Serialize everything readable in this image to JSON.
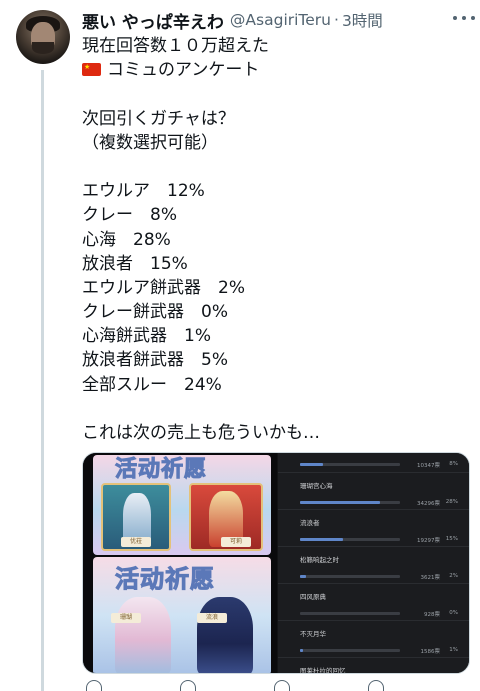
{
  "tweet": {
    "author_name": "悪い やっぱ辛えわ",
    "author_handle": "@AsagiriTeru",
    "separator": "·",
    "time": "3時間",
    "lines": [
      "現在回答数１０万超えた",
      "コミュのアンケート",
      "",
      "次回引くガチャは？",
      "（複数選択可能）",
      "",
      "エウルア　12%",
      "クレー　8%",
      "心海　28%",
      "放浪者　15%",
      "エウルア餅武器　2%",
      "クレー餅武器　0%",
      "心海餅武器　1%",
      "放浪者餅武器　5%",
      "全部スルー　24%",
      "",
      "これは次の売上も危ういかも…"
    ]
  },
  "media": {
    "left": {
      "banner_title_top": "活动祈愿",
      "banner_title_bottom": "活动祈愿",
      "card1_name_left": "优菈",
      "card1_name_right": "可莉",
      "card2_name_left": "珊瑚",
      "card2_name_right": "流浪"
    },
    "poll": [
      {
        "label": "",
        "count": "10347票",
        "pct": "8%",
        "fill": 0.08
      },
      {
        "label": "珊瑚宫心海",
        "count": "34296票",
        "pct": "28%",
        "fill": 0.28
      },
      {
        "label": "流浪者",
        "count": "19297票",
        "pct": "15%",
        "fill": 0.15
      },
      {
        "label": "松籁响起之时",
        "count": "3621票",
        "pct": "2%",
        "fill": 0.02
      },
      {
        "label": "四风原典",
        "count": "928票",
        "pct": "0%",
        "fill": 0.0
      },
      {
        "label": "不灭月华",
        "count": "1586票",
        "pct": "1%",
        "fill": 0.01
      },
      {
        "label": "图莱杜拉的回忆",
        "count": "",
        "pct": "",
        "fill": 0.0
      }
    ]
  },
  "colors": {
    "text": "#0f1419",
    "secondary": "#536471",
    "thread_line": "#cfd9de",
    "flag_red": "#de2910",
    "poll_fill": "#5f86c9"
  }
}
